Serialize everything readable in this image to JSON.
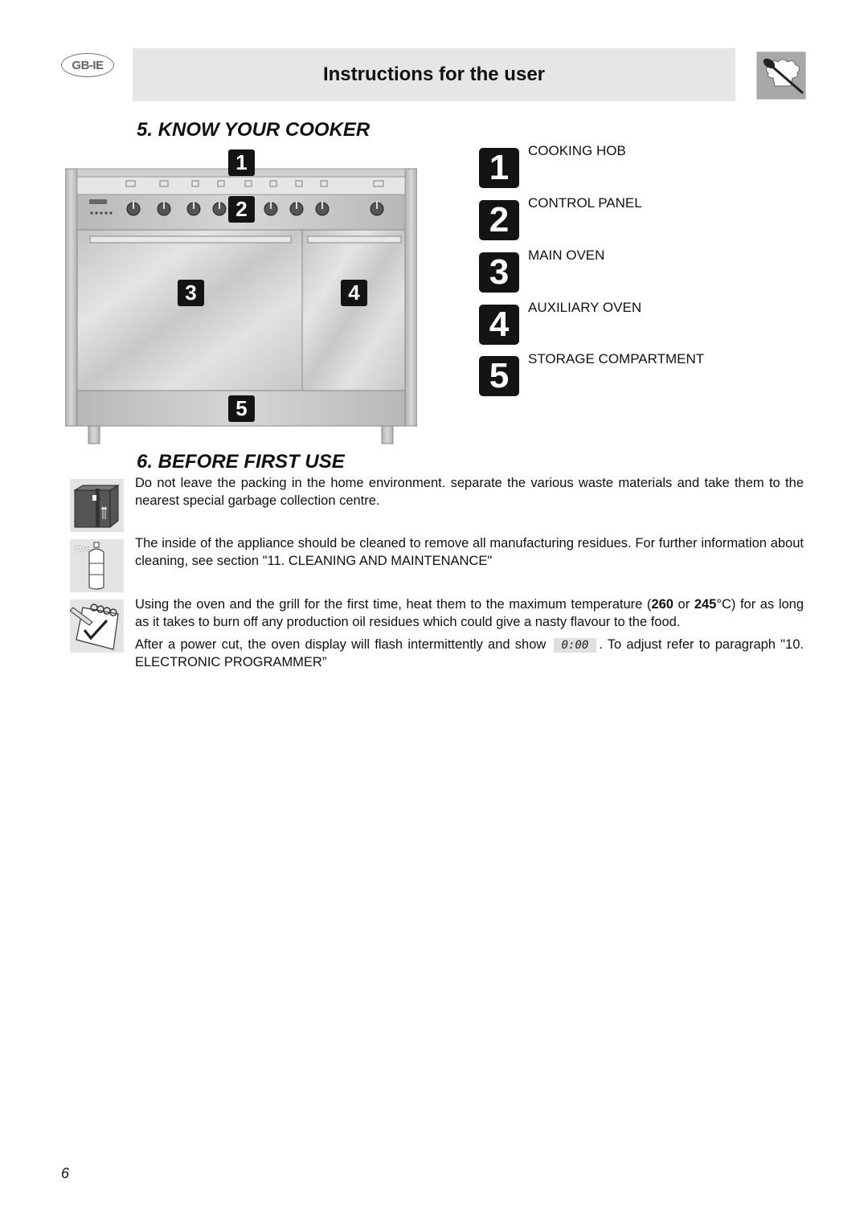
{
  "header": {
    "country_badge": "GB-IE",
    "title": "Instructions for the user",
    "icon": "chef-hat-spoon-icon"
  },
  "section5": {
    "title": "5. KNOW YOUR COOKER",
    "callouts": [
      "1",
      "2",
      "3",
      "4",
      "5"
    ],
    "legend": [
      {
        "number": "1",
        "label": "COOKING HOB"
      },
      {
        "number": "2",
        "label": "CONTROL PANEL"
      },
      {
        "number": "3",
        "label": "MAIN OVEN"
      },
      {
        "number": "4",
        "label": "AUXILIARY OVEN"
      },
      {
        "number": "5",
        "label": "STORAGE COMPARTMENT"
      }
    ]
  },
  "section6": {
    "title": "6. BEFORE FIRST USE",
    "paragraphs": {
      "packing": {
        "icon": "packing-box-icon",
        "text": "Do not leave the packing in the home environment. separate the various waste materials  and take them to the nearest special garbage collection centre."
      },
      "cleaning": {
        "icon": "spray-can-icon",
        "text": "The inside of the appliance should be cleaned to remove all manufacturing residues. For further information about cleaning, see section \"11. CLEANING AND MAINTENANCE\""
      },
      "first_heat": {
        "icon": "notepad-check-icon",
        "before": "Using the oven and the grill for the first time, heat them to the maximum temperature (",
        "temp1": "260",
        "mid": " or ",
        "temp2": "245",
        "after": "°C) for as long as it takes to burn off any production oil residues which could give a nasty flavour to the food."
      },
      "power_cut": {
        "before": "After a power cut, the oven display will flash intermittently and show ",
        "display": "0:00",
        "after": ". To adjust refer to paragraph \"10. ELECTRONIC PROGRAMMER”"
      }
    }
  },
  "footer": {
    "page_number": "6"
  }
}
